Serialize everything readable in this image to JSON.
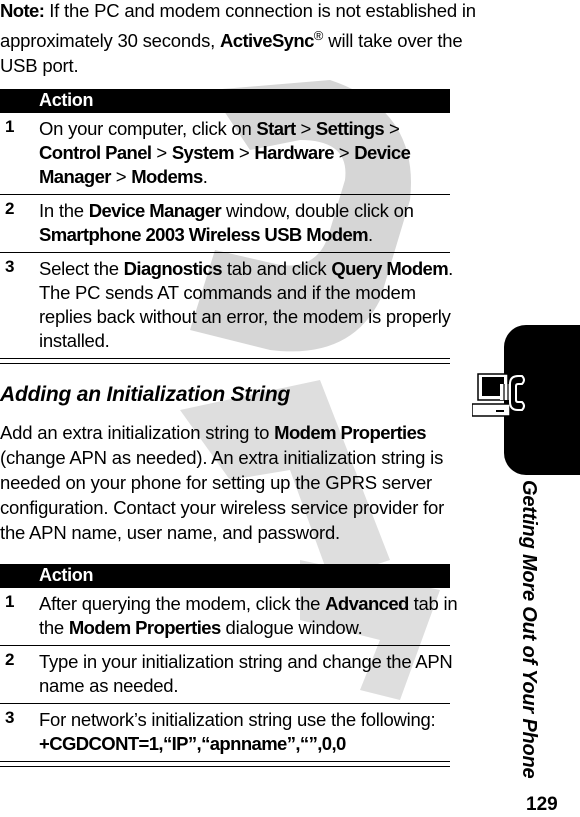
{
  "watermark": "DRAFT",
  "note": {
    "label": "Note:",
    "text_before": " If the PC and modem connection is not established in approximately 30 seconds, ",
    "product": "ActiveSync",
    "registered": "®",
    "text_after": " will take over the USB port."
  },
  "table1": {
    "header": "Action",
    "rows": [
      {
        "num": "1",
        "parts": [
          {
            "t": "On your computer, click on "
          },
          {
            "t": "Start",
            "b": true
          },
          {
            "t": " > "
          },
          {
            "t": "Settings",
            "b": true
          },
          {
            "t": " > "
          },
          {
            "t": "Control Panel",
            "b": true
          },
          {
            "t": " > "
          },
          {
            "t": "System",
            "b": true
          },
          {
            "t": " > "
          },
          {
            "t": "Hardware",
            "b": true
          },
          {
            "t": " > "
          },
          {
            "t": "Device Manager",
            "b": true
          },
          {
            "t": " > "
          },
          {
            "t": "Modems",
            "b": true
          },
          {
            "t": "."
          }
        ]
      },
      {
        "num": "2",
        "parts": [
          {
            "t": "In the "
          },
          {
            "t": "Device Manager",
            "b": true
          },
          {
            "t": " window, double click on "
          },
          {
            "t": "Smartphone 2003 Wireless USB Modem",
            "b": true
          },
          {
            "t": "."
          }
        ]
      },
      {
        "num": "3",
        "parts": [
          {
            "t": "Select the "
          },
          {
            "t": "Diagnostics",
            "b": true
          },
          {
            "t": " tab and click "
          },
          {
            "t": "Query Modem",
            "b": true
          },
          {
            "t": ". The PC sends AT commands and if the modem replies back without an error, the modem is properly installed."
          }
        ]
      }
    ]
  },
  "section": {
    "heading": "Adding an Initialization String",
    "intro_parts": [
      {
        "t": "Add an extra initialization string to "
      },
      {
        "t": "Modem Properties",
        "b": true
      },
      {
        "t": " (change APN as needed). An extra initialization string is needed on your phone for setting up the GPRS server configuration. Contact your wireless service provider for the APN name, user name, and password."
      }
    ]
  },
  "table2": {
    "header": "Action",
    "rows": [
      {
        "num": "1",
        "parts": [
          {
            "t": "After querying the modem, click the "
          },
          {
            "t": "Advanced",
            "b": true
          },
          {
            "t": " tab in the "
          },
          {
            "t": "Modem Properties",
            "b": true
          },
          {
            "t": " dialogue window."
          }
        ]
      },
      {
        "num": "2",
        "parts": [
          {
            "t": "Type in your initialization string and change the APN name as needed."
          }
        ]
      },
      {
        "num": "3",
        "parts": [
          {
            "t": "For network’s initialization string use the following: "
          },
          {
            "t": "+CGDCONT=1,“IP”,“apnname”,“”,0,0",
            "b": true
          }
        ]
      }
    ]
  },
  "sidebar": {
    "chapter_title": "Getting More Out of Your Phone",
    "icon": "computer-phone-connection-icon",
    "page_number": "129"
  }
}
